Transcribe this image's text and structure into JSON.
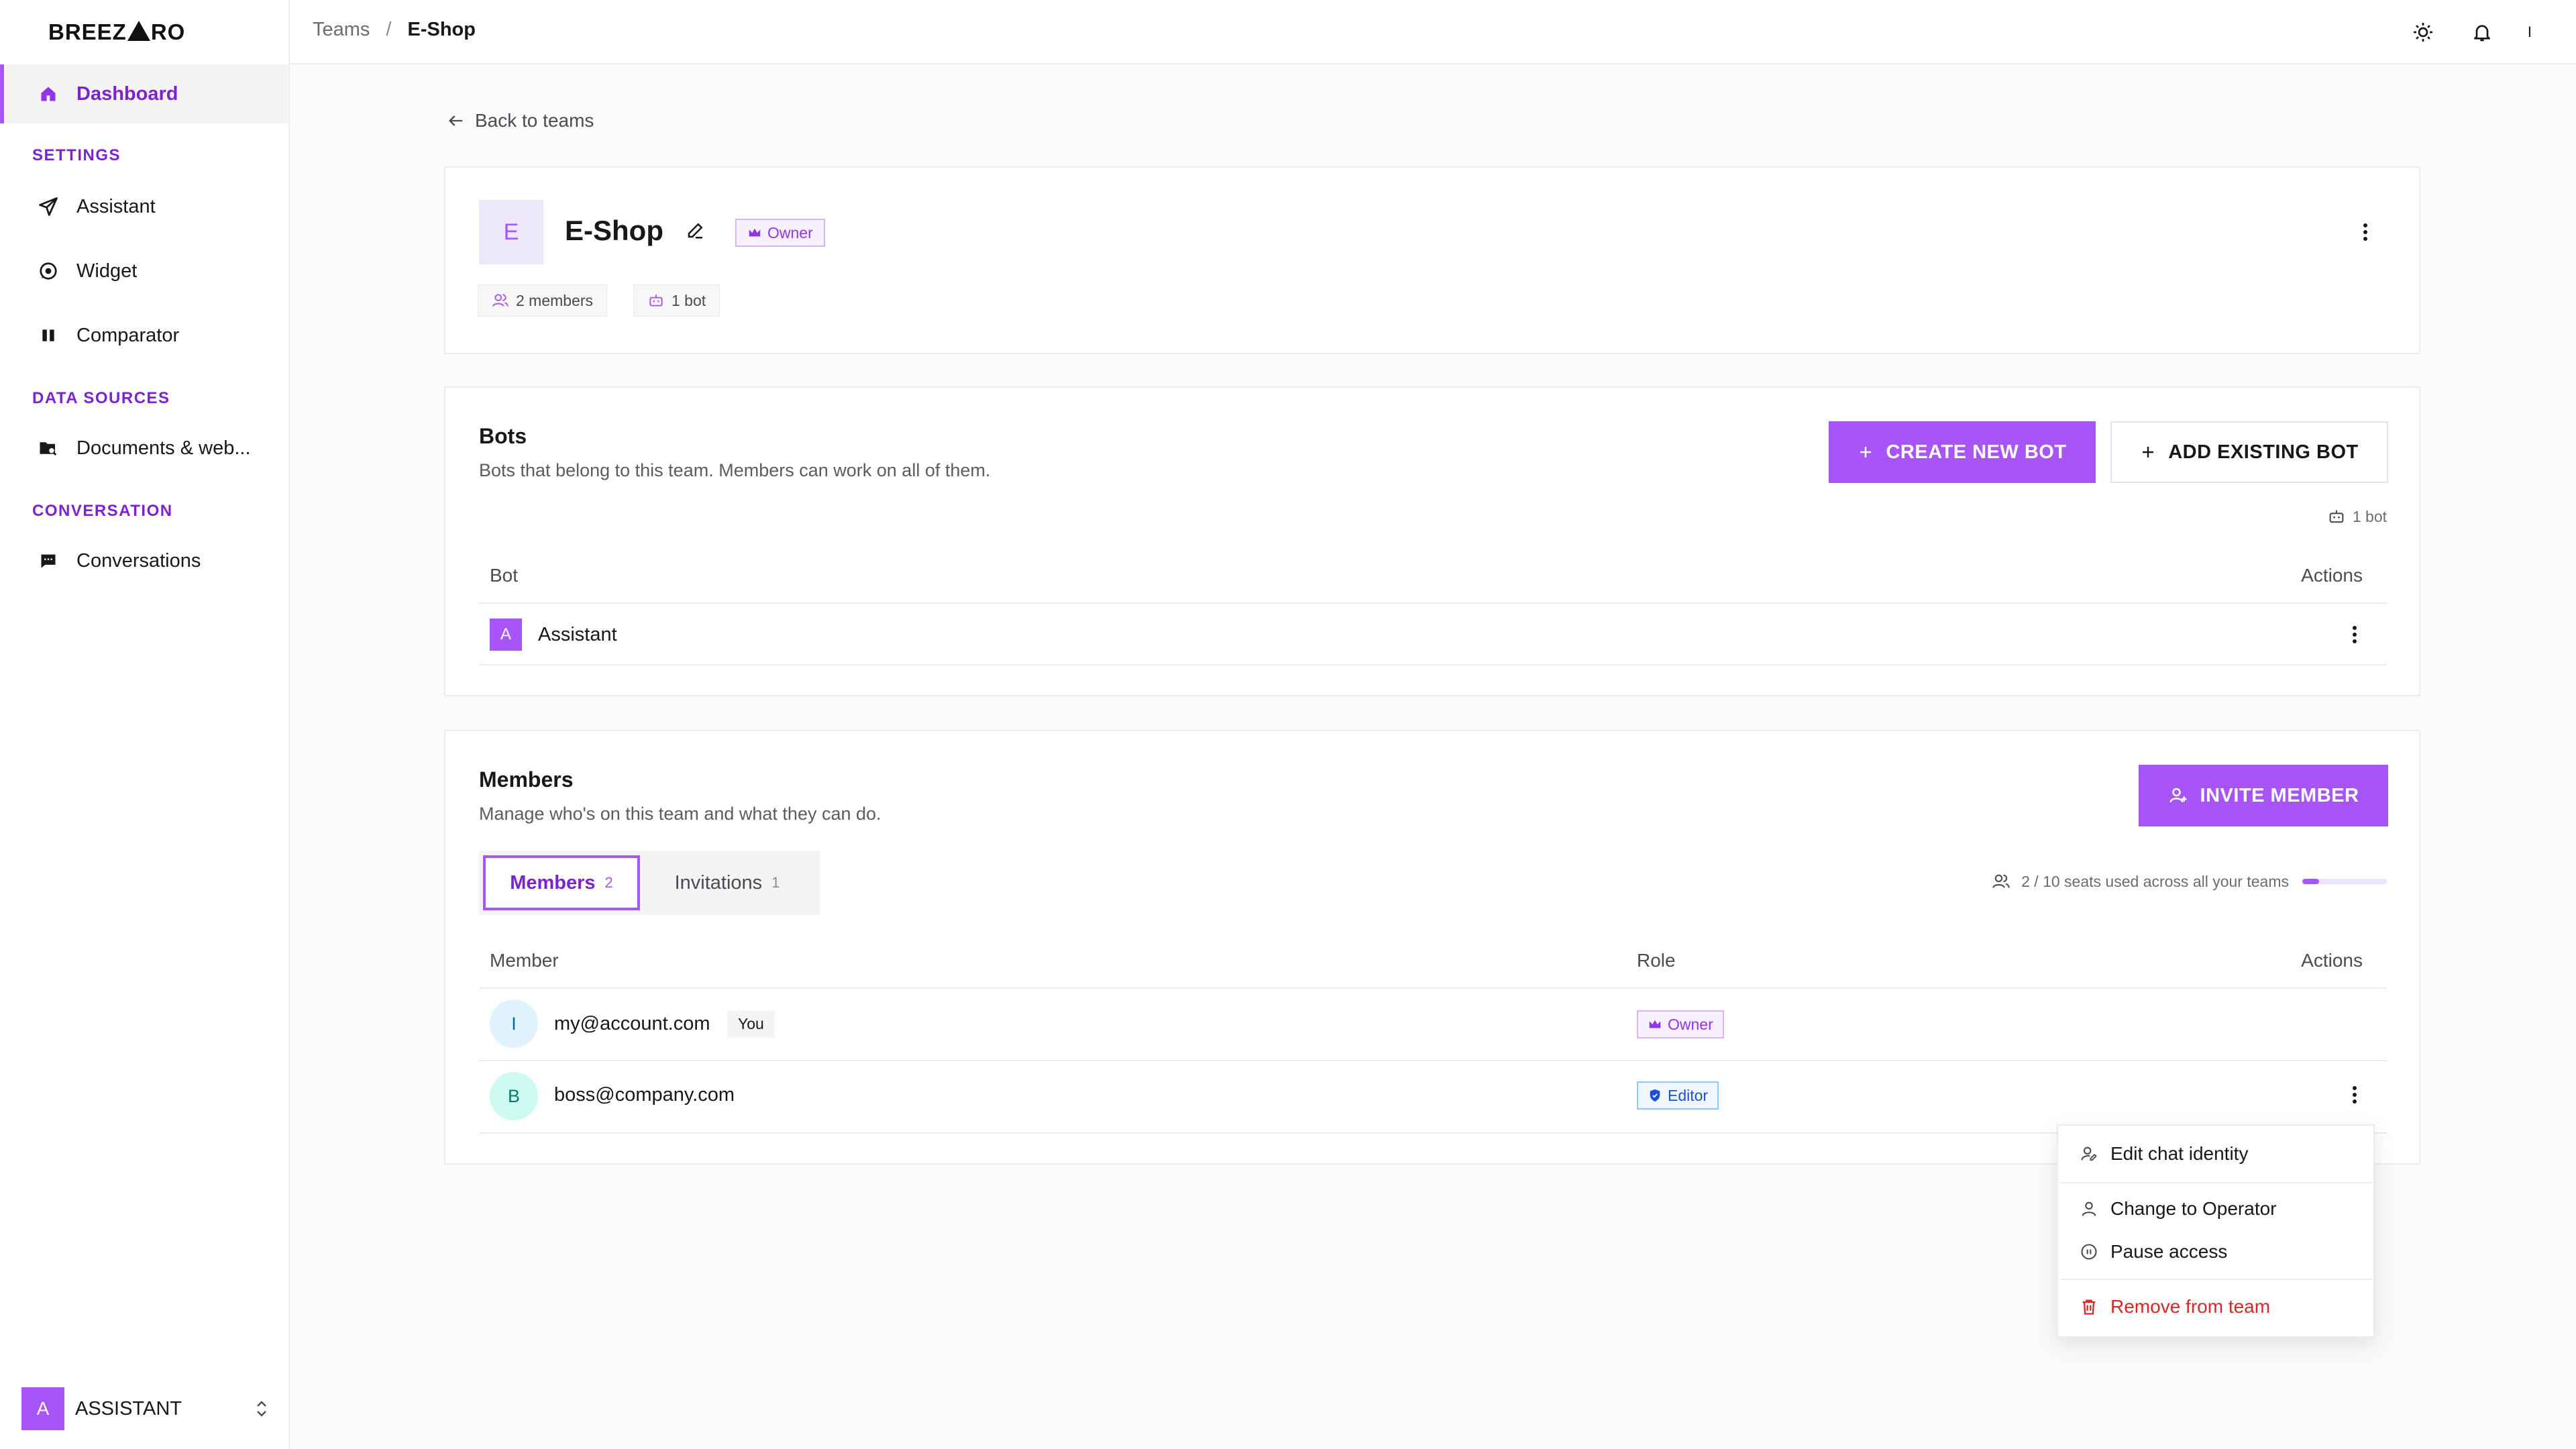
{
  "app": {
    "logo_prefix": "BREEZ",
    "logo_suffix": "RO"
  },
  "sidebar": {
    "dashboard": "Dashboard",
    "section_settings": "SETTINGS",
    "assistant": "Assistant",
    "widget": "Widget",
    "comparator": "Comparator",
    "section_data": "DATA SOURCES",
    "documents": "Documents & web...",
    "section_conversation": "CONVERSATION",
    "conversations": "Conversations",
    "workspace_initial": "A",
    "workspace_name": "ASSISTANT"
  },
  "topbar": {
    "crumb_teams": "Teams",
    "crumb_sep": "/",
    "crumb_current": "E-Shop",
    "user_initial": "I"
  },
  "back_label": "Back to teams",
  "team": {
    "initial": "E",
    "name": "E-Shop",
    "role_badge": "Owner",
    "members_chip": "2 members",
    "bots_chip": "1 bot"
  },
  "bots": {
    "title": "Bots",
    "subtitle": "Bots that belong to this team. Members can work on all of them.",
    "create_label": "CREATE NEW BOT",
    "add_label": "ADD EXISTING BOT",
    "count_label": "1 bot",
    "col_bot": "Bot",
    "col_actions": "Actions",
    "rows": [
      {
        "initial": "A",
        "name": "Assistant"
      }
    ]
  },
  "members": {
    "title": "Members",
    "subtitle": "Manage who's on this team and what they can do.",
    "invite_label": "INVITE MEMBER",
    "tab_members": "Members",
    "tab_members_count": "2",
    "tab_invitations": "Invitations",
    "tab_invitations_count": "1",
    "seats_label": "2 / 10 seats used across all your teams",
    "seats_fraction": 0.2,
    "col_member": "Member",
    "col_role": "Role",
    "col_actions": "Actions",
    "rows": [
      {
        "initial": "I",
        "email": "my@account.com",
        "you": "You",
        "role": "Owner"
      },
      {
        "initial": "B",
        "email": "boss@company.com",
        "role": "Editor"
      }
    ]
  },
  "menu": {
    "edit_identity": "Edit chat identity",
    "change_operator": "Change to Operator",
    "pause_access": "Pause access",
    "remove": "Remove from team"
  },
  "colors": {
    "accent": "#a855f7",
    "danger": "#dc2626",
    "editor": "#1d4ed8"
  }
}
